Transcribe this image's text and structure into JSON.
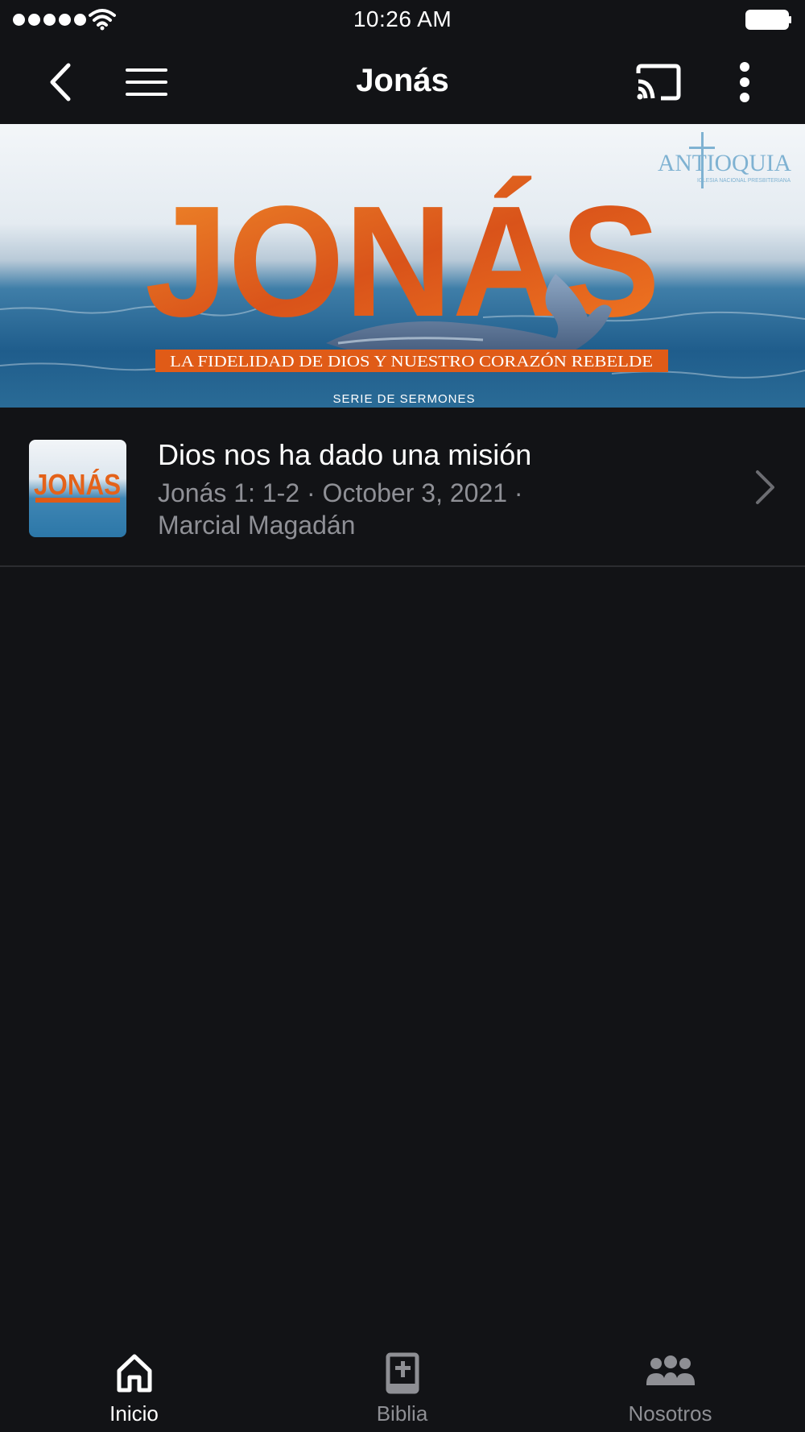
{
  "status_bar": {
    "time": "10:26 AM"
  },
  "nav": {
    "title": "Jonás",
    "back_icon": "chevron-left-icon",
    "menu_icon": "hamburger-icon",
    "cast_icon": "cast-icon",
    "more_icon": "more-vertical-icon"
  },
  "banner": {
    "title": "JONÁS",
    "subtitle": "LA FIDELIDAD DE DIOS Y NUESTRO CORAZÓN REBELDE",
    "caption": "SERIE DE SERMONES",
    "logo_text": "ANTIOQUIA",
    "logo_subtext": "IGLESIA NACIONAL PRESBITERIANA"
  },
  "sermons": [
    {
      "title": "Dios nos ha dado una misión",
      "meta_line1": "Jonás 1: 1-2 · October 3, 2021 ·",
      "meta_line2": "Marcial Magadán",
      "thumb_text": "JONÁS"
    }
  ],
  "tabs": [
    {
      "label": "Inicio",
      "icon": "home-icon",
      "active": true
    },
    {
      "label": "Biblia",
      "icon": "bible-icon",
      "active": false
    },
    {
      "label": "Nosotros",
      "icon": "people-icon",
      "active": false
    }
  ],
  "colors": {
    "background": "#121316",
    "accent_orange": "#e8661c",
    "secondary_text": "#8f9096"
  }
}
